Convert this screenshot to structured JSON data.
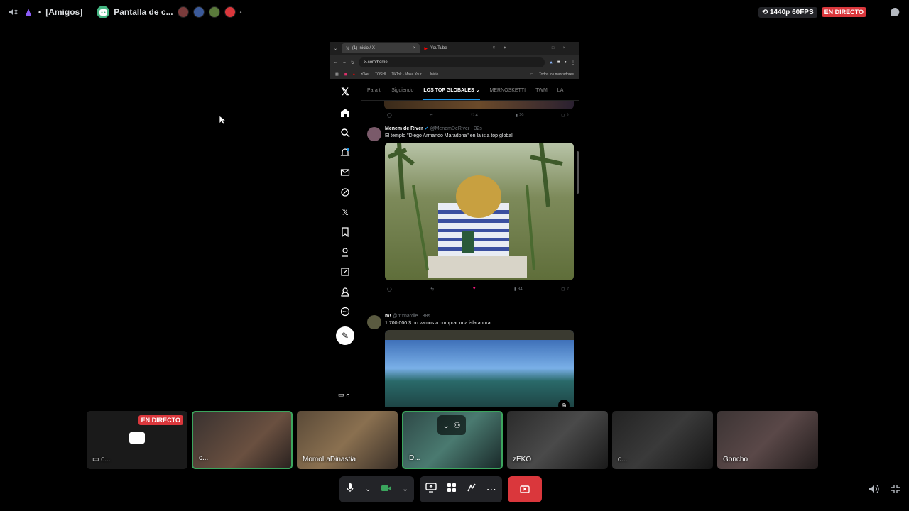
{
  "topbar": {
    "channel": "[Amigos]",
    "stream_title": "Pantalla de c...",
    "quality": "1440p 60FPS",
    "live": "EN DIRECTO"
  },
  "browser": {
    "tabs": [
      "(1) Inicio / X",
      "YouTube"
    ],
    "url": "x.com/home",
    "bookmarks": [
      "z0ker",
      "TOSHI",
      "TikTok - Make Your...",
      "Inicio"
    ],
    "all_bookmarks": "Todos los marcadores"
  },
  "x": {
    "tabs": [
      "Para ti",
      "Siguiendo",
      "LOS TOP GLOBALES",
      "MERNOSKETTI",
      "TWM",
      "LA"
    ],
    "post0_counts": {
      "likes": "4",
      "views": "29"
    },
    "post1": {
      "name": "Menem de River",
      "handle": "@MenemDeRiver · 32s",
      "text": "El templo \"Diego Armando Maradona\" en la isla top global",
      "views": "34"
    },
    "post2": {
      "name": "m!",
      "handle": "@mxnardie · 38s",
      "text": "1.700.000 $ no vamos a comprar una isla ahora"
    }
  },
  "participants": [
    {
      "name": "c...",
      "live": "EN DIRECTO",
      "color": "#1a1a1a"
    },
    {
      "name": "c...",
      "color": "#3a3230"
    },
    {
      "name": "MomoLaDinastia",
      "color": "#5a4a38"
    },
    {
      "name": "D...",
      "color": "#2f4a48"
    },
    {
      "name": "zEKO",
      "color": "#2b2b2b"
    },
    {
      "name": "c...",
      "color": "#232323"
    },
    {
      "name": "Goncho",
      "color": "#3c3434"
    }
  ],
  "screen_label": "c..."
}
